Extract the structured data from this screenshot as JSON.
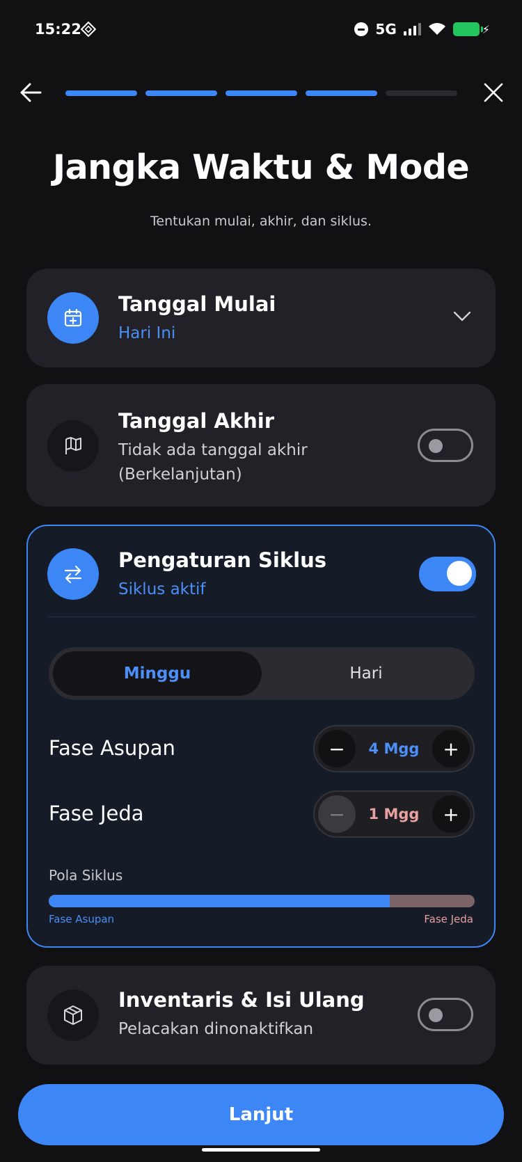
{
  "status_bar": {
    "time": "15:22",
    "network": "5G"
  },
  "header": {
    "progress_total": 5,
    "progress_done": 4,
    "title": "Jangka Waktu & Mode",
    "subtitle": "Tentukan mulai, akhir, dan siklus."
  },
  "start_date": {
    "title": "Tanggal Mulai",
    "value": "Hari Ini"
  },
  "end_date": {
    "title": "Tanggal Akhir",
    "value_line1": "Tidak ada tanggal akhir",
    "value_line2": "(Berkelanjutan)",
    "enabled": false
  },
  "cycle": {
    "title": "Pengaturan Siklus",
    "status": "Siklus aktif",
    "enabled": true,
    "unit_options": [
      "Minggu",
      "Hari"
    ],
    "selected_unit": "Minggu",
    "intake_label": "Fase Asupan",
    "intake_value": "4 Mgg",
    "pause_label": "Fase Jeda",
    "pause_value": "1 Mgg",
    "pattern_label": "Pola Siklus",
    "pattern_intake_caption": "Fase Asupan",
    "pattern_pause_caption": "Fase Jeda",
    "intake_fraction": 0.8,
    "colors": {
      "intake": "#3d86f5",
      "pause": "#e8a0a0"
    }
  },
  "inventory": {
    "title": "Inventaris & Isi Ulang",
    "status": "Pelacakan dinonaktifkan",
    "enabled": false
  },
  "cta": {
    "label": "Lanjut"
  }
}
